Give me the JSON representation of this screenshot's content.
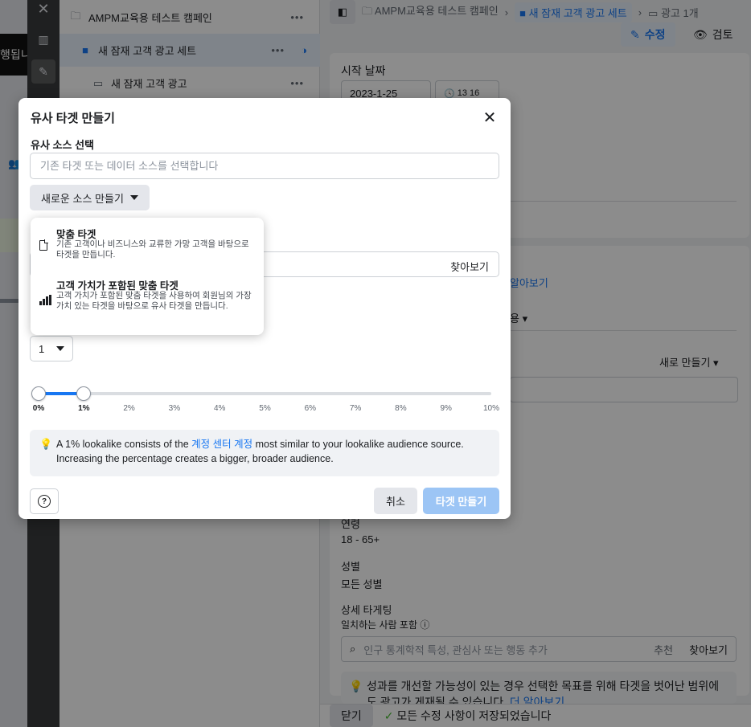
{
  "background": {
    "left_clip_text": "행됩니",
    "tree": [
      {
        "label": "AMPM교육용 테스트 캠페인",
        "icon": "folder-icon",
        "dots": "•••"
      },
      {
        "label": "새 잠재 고객 광고 세트",
        "icon": "grid-icon",
        "dots": "•••"
      },
      {
        "label": "새 잠재 고객 광고",
        "icon": "ad-icon",
        "dots": "•••"
      }
    ],
    "breadcrumb": {
      "campaign": "AMPM교육용 테스트 캠페인",
      "adset": "새 잠재 고객 광고 세트",
      "ads": "광고 1개"
    },
    "edit_label": "수정",
    "review_label": "검토",
    "start_date_label": "시작 날짜",
    "start_date_value": "2023-1-25",
    "start_time_value": "13 16",
    "learn_more": "알아보기",
    "apply_suffix": "용",
    "new_create": "새로 만들기",
    "age_label": "연령",
    "age_value": "18 - 65+",
    "gender_label": "성별",
    "gender_value": "모든 성별",
    "detail_label": "상세 타게팅",
    "detail_sub": "일치하는 사람 포함",
    "detail_placeholder": "인구 통계학적 특성, 관심사 또는 행동 추가",
    "suggest": "추천",
    "browse": "찾아보기",
    "tip_text": "성과를 개선할 가능성이 있는 경우 선택한 목표를 위해 타겟을 벗어난 범위에도 광고가 게재될 수 있습니다.",
    "tip_link": "더 알아보기",
    "close_label": "닫기",
    "saved_label": "모든 수정 사항이 저장되었습니다"
  },
  "modal": {
    "title": "유사 타겟 만들기",
    "source_label": "유사 소스 선택",
    "source_placeholder": "기존 타겟 또는 데이터 소스를 선택합니다",
    "new_source_label": "새로운 소스 만들기",
    "location_browse": "찾아보기",
    "audience_count": "1",
    "slider": {
      "ticks": [
        "0%",
        "1%",
        "2%",
        "3%",
        "4%",
        "5%",
        "6%",
        "7%",
        "8%",
        "9%",
        "10%"
      ],
      "range_start": 0,
      "range_end": 1,
      "max": 10
    },
    "info_pre": "A 1% lookalike consists of the",
    "info_link": "계정 센터 계정",
    "info_post": "most similar to your lookalike audience source. Increasing the percentage creates a bigger, broader audience.",
    "cancel_label": "취소",
    "create_label": "타겟 만들기"
  },
  "dropdown": {
    "items": [
      {
        "title": "맞춤 타겟",
        "description": "기존 고객이나 비즈니스와 교류한 가망 고객을 바탕으로 타겟을 만듭니다.",
        "icon": "document-icon"
      },
      {
        "title": "고객 가치가 포함된 맞춤 타겟",
        "description": "고객 가치가 포함된 맞춤 타겟을 사용하여 회원님의 가장 가치 있는 타겟을 바탕으로 유사 타겟을 만듭니다.",
        "icon": "bar-chart-icon"
      }
    ]
  },
  "colors": {
    "accent": "#1877f2",
    "disabled_primary": "#9cc5f5",
    "overlay": "rgba(0,0,0,0.45)"
  }
}
